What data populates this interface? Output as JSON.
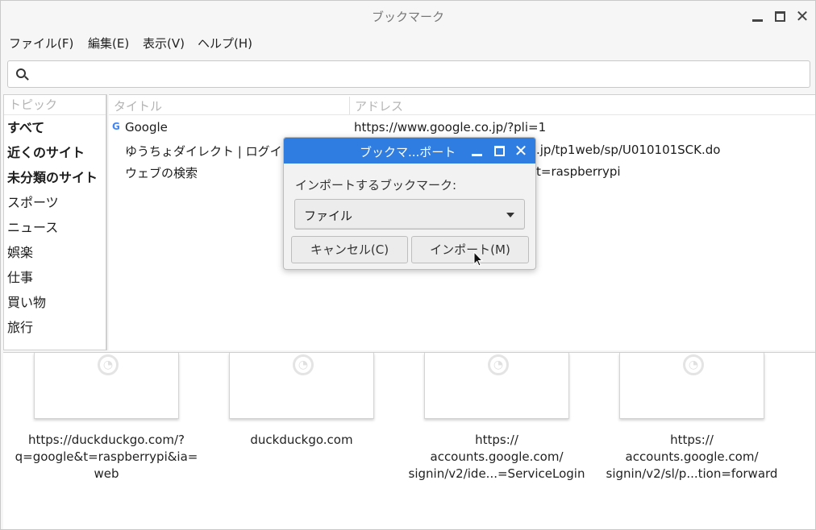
{
  "window": {
    "title": "ブックマーク"
  },
  "menu": [
    "ファイル(F)",
    "編集(E)",
    "表示(V)",
    "ヘルプ(H)"
  ],
  "search": {
    "value": "",
    "placeholder": ""
  },
  "topics": {
    "header": "トピック",
    "items": [
      {
        "label": "すべて",
        "bold": true
      },
      {
        "label": "近くのサイト",
        "bold": true
      },
      {
        "label": "未分類のサイト",
        "bold": true
      },
      {
        "label": "スポーツ",
        "bold": false
      },
      {
        "label": "ニュース",
        "bold": false
      },
      {
        "label": "娯楽",
        "bold": false
      },
      {
        "label": "仕事",
        "bold": false
      },
      {
        "label": "買い物",
        "bold": false
      },
      {
        "label": "旅行",
        "bold": false
      }
    ]
  },
  "table": {
    "col_title": "タイトル",
    "col_address": "アドレス",
    "rows": [
      {
        "title": "Google",
        "address": "https://www.google.co.jp/?pli=1",
        "icon": "google-favicon-icon"
      },
      {
        "title": "ゆうちょダイレクト | ログイ",
        "address": ".jp/tp1web/sp/U010101SCK.do",
        "icon": ""
      },
      {
        "title": "ウェブの検索",
        "address": "t=raspberrypi",
        "icon": ""
      }
    ]
  },
  "thumbnails": [
    {
      "label": "https://duckduckgo.com/?\nq=google&t=raspberrypi&ia=\nweb"
    },
    {
      "label": "duckduckgo.com"
    },
    {
      "label": "https://\naccounts.google.com/\nsignin/v2/ide...=ServiceLogin"
    },
    {
      "label": "https://\naccounts.google.com/\nsignin/v2/sl/p...tion=forward"
    }
  ],
  "dialog": {
    "title": "ブックマ...ポート",
    "label": "インポートするブックマーク:",
    "select_value": "ファイル",
    "cancel": "キャンセル(C)",
    "import": "インポート(M)"
  },
  "colors": {
    "dialog_titlebar": "#2f7de1",
    "background": "#f6f6f6"
  }
}
